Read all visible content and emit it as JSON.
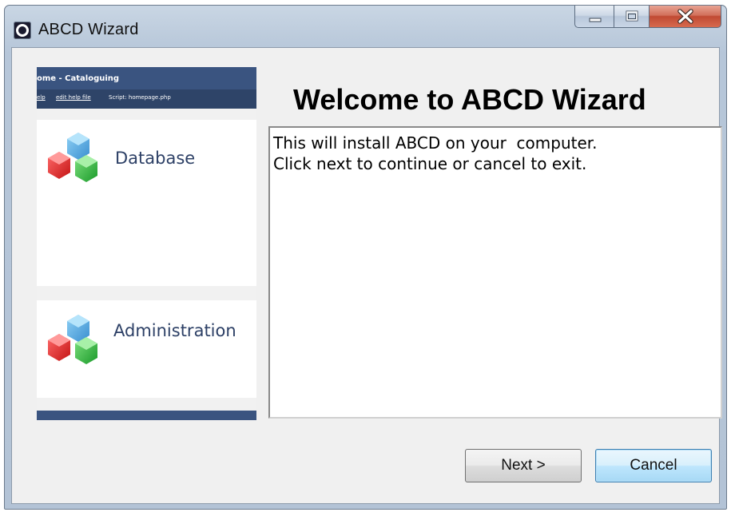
{
  "window": {
    "title": "ABCD  Wizard",
    "app_icon": "app-logo-icon",
    "controls": {
      "minimize_icon": "minimize-icon",
      "maximize_icon": "maximize-icon",
      "close_icon": "close-icon"
    }
  },
  "side_panel": {
    "header_title": "ome - Cataloguing",
    "header_links": [
      "elp",
      "edit help file",
      "Script: homepage.php"
    ],
    "modules": [
      {
        "label": "Database",
        "icon": "cubes-icon"
      },
      {
        "label": "Administration",
        "icon": "cubes-icon"
      }
    ]
  },
  "main": {
    "title": "Welcome to ABCD Wizard",
    "message_lines": [
      "This will install ABCD on your  computer.",
      "Click next to continue or cancel to exit."
    ]
  },
  "buttons": {
    "next_label": "Next >",
    "cancel_label": "Cancel"
  },
  "colors": {
    "header_blue": "#3a5480",
    "module_text": "#2d4066",
    "close_red": "#c04a33",
    "focus_blue": "#3c7fb1"
  }
}
